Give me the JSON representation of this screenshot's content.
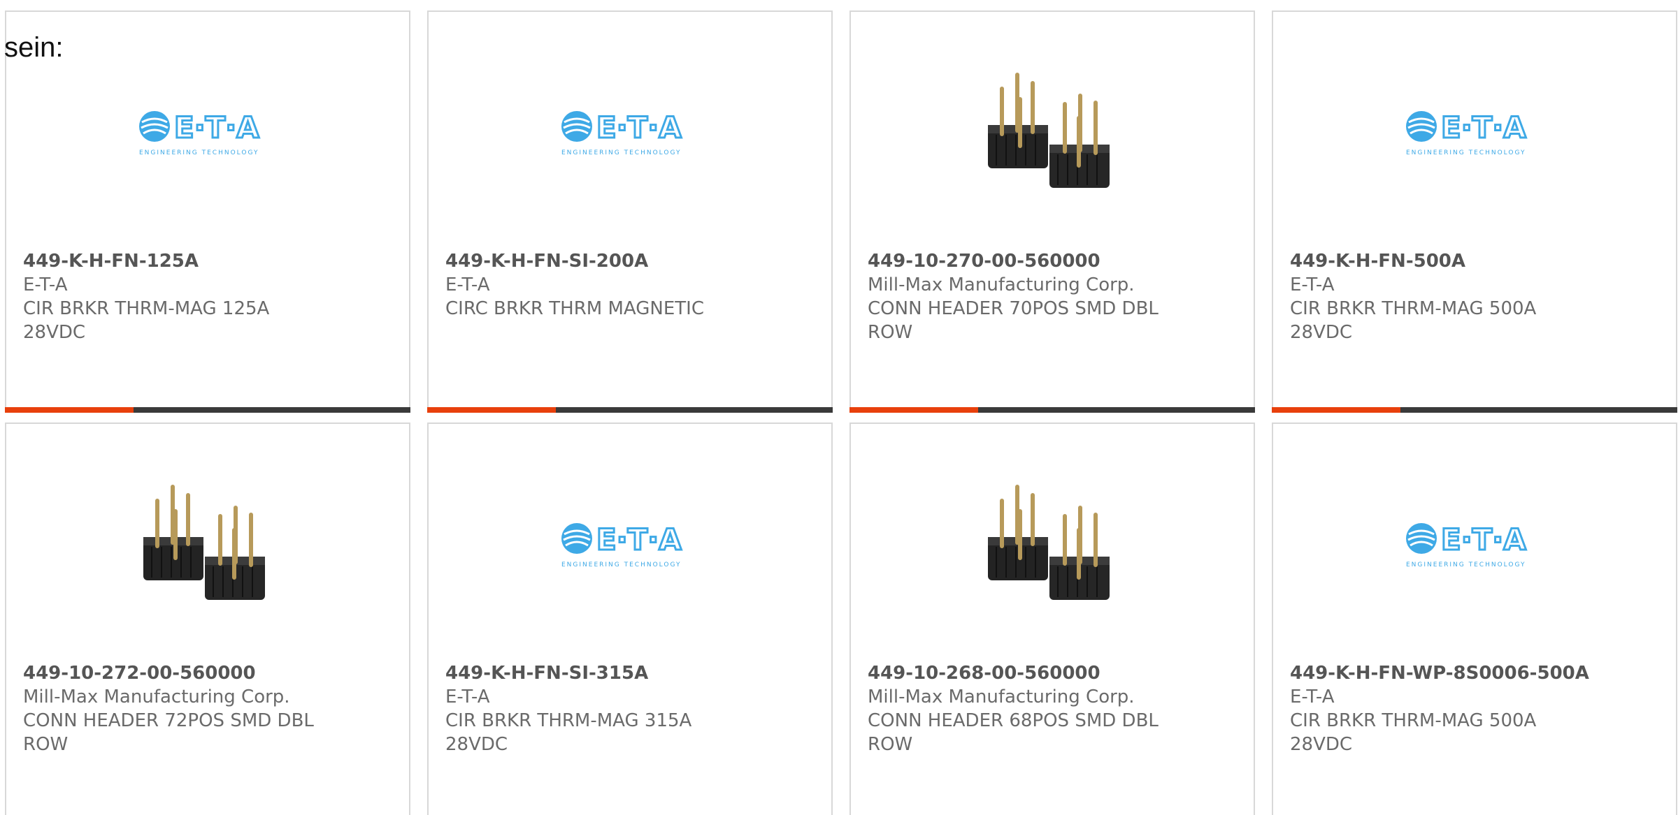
{
  "intro_text": "sein:",
  "eta_logo": {
    "wordmark": "E·T·A",
    "tagline": "ENGINEERING TECHNOLOGY",
    "color": "#3ea9e6"
  },
  "colors": {
    "accent": "#e8400c",
    "bar": "#3a3a3a",
    "border": "#d8d8d8",
    "text": "#6a6a6a"
  },
  "products": [
    {
      "part_number": "449-K-H-FN-125A",
      "manufacturer": "E-T-A",
      "description": "CIR BRKR THRM-MAG 125A 28VDC",
      "image": "eta-logo"
    },
    {
      "part_number": "449-K-H-FN-SI-200A",
      "manufacturer": "E-T-A",
      "description": "CIRC BRKR THRM MAGNETIC",
      "image": "eta-logo"
    },
    {
      "part_number": "449-10-270-00-560000",
      "manufacturer": "Mill-Max Manufacturing Corp.",
      "description": "CONN HEADER 70POS SMD DBL ROW",
      "image": "pin-header-photo"
    },
    {
      "part_number": "449-K-H-FN-500A",
      "manufacturer": "E-T-A",
      "description": "CIR BRKR THRM-MAG 500A 28VDC",
      "image": "eta-logo"
    },
    {
      "part_number": "449-10-272-00-560000",
      "manufacturer": "Mill-Max Manufacturing Corp.",
      "description": "CONN HEADER 72POS SMD DBL ROW",
      "image": "pin-header-photo"
    },
    {
      "part_number": "449-K-H-FN-SI-315A",
      "manufacturer": "E-T-A",
      "description": "CIR BRKR THRM-MAG 315A 28VDC",
      "image": "eta-logo"
    },
    {
      "part_number": "449-10-268-00-560000",
      "manufacturer": "Mill-Max Manufacturing Corp.",
      "description": "CONN HEADER 68POS SMD DBL ROW",
      "image": "pin-header-photo"
    },
    {
      "part_number": "449-K-H-FN-WP-8S0006-500A",
      "manufacturer": "E-T-A",
      "description": "CIR BRKR THRM-MAG 500A 28VDC",
      "image": "eta-logo"
    }
  ]
}
